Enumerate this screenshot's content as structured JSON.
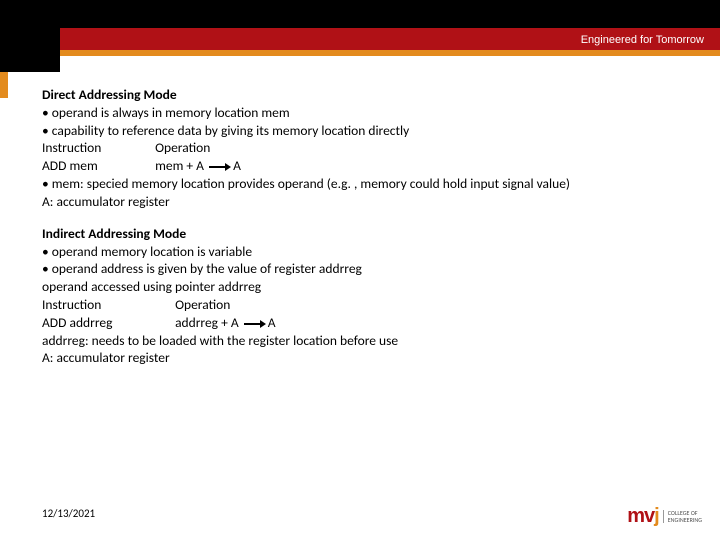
{
  "header": {
    "tagline": "Engineered for Tomorrow"
  },
  "section1": {
    "title": "Direct Addressing Mode",
    "b1": "• operand is always in memory location mem",
    "b2": "• capability to reference data by giving its memory location directly",
    "instr_label": "Instruction",
    "op_label": "Operation",
    "instr_val": "ADD mem",
    "op_val_left": "mem + A",
    "op_val_right": "A",
    "b3": "• mem:  specied memory location provides operand (e.g. , memory could hold input signal value)",
    "b4": " A: accumulator register"
  },
  "section2": {
    "title": "Indirect Addressing Mode",
    "b1": "• operand memory location is variable",
    "b2": "• operand address is given by the value of register addrreg",
    "b3": "operand accessed using pointer addrreg",
    "instr_label": "Instruction",
    "op_label": "Operation",
    "instr_val": "ADD addrreg",
    "op_val_left": "addrreg + A",
    "op_val_right": "A",
    "b4": "addrreg: needs to be loaded with the register location before use",
    "b5": " A: accumulator register"
  },
  "footer": {
    "date": "12/13/2021",
    "logo_m": "m",
    "logo_v": "v",
    "logo_j": "j",
    "logo_text": "COLLEGE OF\nENGINEERING"
  }
}
